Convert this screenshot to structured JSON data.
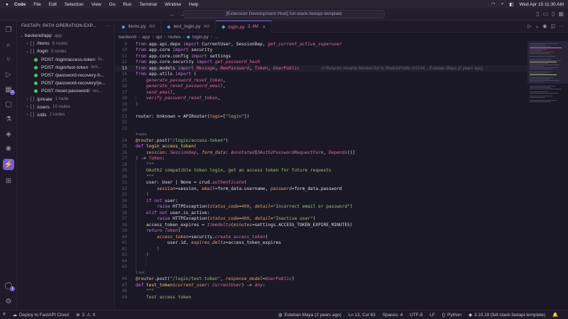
{
  "menubar": {
    "app": "Code",
    "items": [
      "File",
      "Edit",
      "Selection",
      "View",
      "Go",
      "Run",
      "Terminal",
      "Window",
      "Help"
    ],
    "datetime": "Wed Apr 15  11:30 AM"
  },
  "titlebar": {
    "command_center": "[Extension Development Host] full-stack-fastapi-template"
  },
  "sidebar": {
    "title": "FASTAPI: PATH OPERATION EXP...",
    "root": {
      "label": "backend/app",
      "meta": "app"
    },
    "groups": [
      {
        "label": "/items",
        "count": "6 routes",
        "expanded": false
      },
      {
        "label": "/login",
        "count": "5 routes",
        "expanded": true,
        "routes": [
          {
            "label": "POST /login/access-token",
            "meta": "lo..."
          },
          {
            "label": "POST /login/test-token",
            "meta": "test..."
          },
          {
            "label": "POST /password-recovery-h...",
            "meta": ""
          },
          {
            "label": "POST /password-recovery/{e...",
            "meta": ""
          },
          {
            "label": "POST /reset-password/",
            "meta": "res..."
          }
        ]
      },
      {
        "label": "/private",
        "count": "1 route",
        "expanded": false
      },
      {
        "label": "/users",
        "count": "10 routes",
        "expanded": false
      },
      {
        "label": "/utils",
        "count": "2 routes",
        "expanded": false
      }
    ]
  },
  "tabs": [
    {
      "name": "items.py",
      "mod": "4M"
    },
    {
      "name": "test_login.py",
      "mod": "4M"
    },
    {
      "name": "login.py",
      "mod": "3, 4M"
    }
  ],
  "breadcrumbs": [
    "backend",
    "app",
    "api",
    "routes",
    "login.py",
    "..."
  ],
  "blame": "Refactor rename ModelsOut to ModelsPublic (#1154... Esteban Maya (2 years ago)",
  "codelens": [
    "4 tests",
    "1 test"
  ],
  "line_numbers": [
    "9",
    "10",
    "11",
    "12",
    "13",
    "14",
    "15",
    "16",
    "17",
    "18",
    "19",
    "20",
    "21",
    "22",
    "23",
    "24",
    "25",
    "26",
    "27",
    "28",
    "29",
    "30",
    "31",
    "32",
    "33",
    "34",
    "35",
    "36",
    "37",
    "38",
    "39",
    "40",
    "41",
    "42",
    "43",
    "44",
    "45",
    "46",
    "47",
    "48",
    "49"
  ],
  "activity_badges": {
    "source_control": "2",
    "accounts": "1"
  },
  "status": {
    "deploy": "Deploy to FastAPI Cloud",
    "problems": "3",
    "warnings": "0",
    "blame": "Esteban Maya (2 years ago)",
    "position": "Ln 13, Col 63",
    "spaces": "Spaces: 4",
    "encoding": "UTF-8",
    "eol": "LF",
    "language": "Python",
    "interpreter": "3.10.19 (full-stack-fastapi-template)"
  }
}
